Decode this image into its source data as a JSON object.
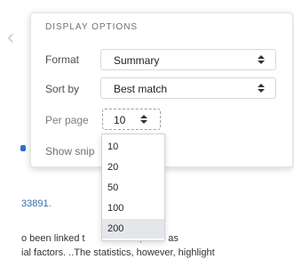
{
  "panel": {
    "title": "DISPLAY OPTIONS",
    "format": {
      "label": "Format",
      "value": "Summary"
    },
    "sort": {
      "label": "Sort by",
      "value": "Best match"
    },
    "per_page": {
      "label": "Per page",
      "value": "10"
    },
    "show_snippets_label": "Show snip"
  },
  "dropdown": {
    "options": [
      "10",
      "20",
      "50",
      "100",
      "200"
    ],
    "highlighted": "200"
  },
  "background": {
    "id_text": "33891.",
    "line1_a": "o been linked t",
    "line1_b": "ors, such as",
    "line2": "ial factors. ..The statistics, however, highlight"
  }
}
